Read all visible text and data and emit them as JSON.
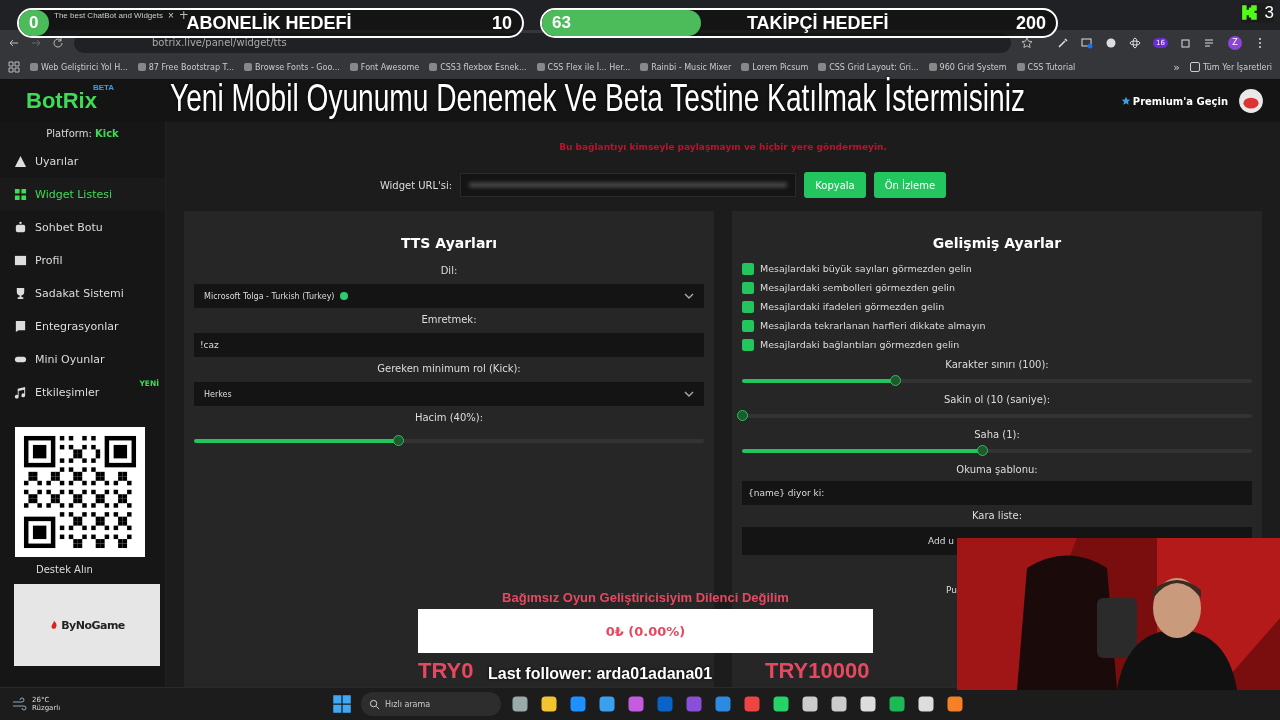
{
  "browser": {
    "tab_title": "The best ChatBot and Widgets",
    "tab_close": "×",
    "new_tab": "+",
    "url": "botrix.live/panel/widget/tts",
    "bookmarks": [
      "Web Geliştirici Yol H...",
      "87 Free Bootstrap T...",
      "Browse Fonts - Goo...",
      "Font Awesome",
      "CSS3 flexbox Esnek...",
      "CSS Flex ile İ... Her...",
      "Rainbi - Music Mixer",
      "Lorem Picsum",
      "CSS Grid Layout: Gri...",
      "960 Grid System",
      "CSS Tutorial"
    ],
    "more": "»",
    "all_bookmarks": "Tüm Yer İşaretleri",
    "extension_badge": "16",
    "profile": "Z"
  },
  "app": {
    "logo": "BotRix",
    "logo_badge": "BETA",
    "premium": "Premium'a Geçin",
    "platform_label": "Platform:",
    "platform": "Kick",
    "sidebar": [
      {
        "label": "Uyarılar",
        "selected": false
      },
      {
        "label": "Widget Listesi",
        "selected": true
      },
      {
        "label": "Sohbet Botu",
        "selected": false
      },
      {
        "label": "Profil",
        "selected": false
      },
      {
        "label": "Sadakat Sistemi",
        "selected": false
      },
      {
        "label": "Entegrasyonlar",
        "selected": false
      },
      {
        "label": "Mini Oyunlar",
        "selected": false
      },
      {
        "label": "Etkileşimler",
        "selected": false,
        "badge": "YENİ"
      }
    ],
    "support": "Destek Alın",
    "warning": "Bu bağlantıyı kimseyle paylaşmayın ve hiçbir yere göndermeyin.",
    "url_label": "Widget URL'si:",
    "copy_button": "Kopyala",
    "preview_button": "Ön İzleme",
    "tts": {
      "title": "TTS Ayarları",
      "fields": [
        {
          "kind": "select",
          "label": "Dil:",
          "value": "Microsoft Tolga - Turkish (Turkey)",
          "color": "#2ecc71"
        },
        {
          "kind": "input",
          "label": "Emretmek:",
          "value": "!caz"
        },
        {
          "kind": "select",
          "label": "Gereken minimum rol (Kick):",
          "value": "Herkes"
        },
        {
          "kind": "slider",
          "label": "Hacim (40%):",
          "level": 0.4
        }
      ]
    },
    "advanced": {
      "title": "Gelişmiş Ayarlar",
      "options": [
        {
          "label": "Mesajlardaki büyük sayıları görmezden gelin",
          "checked": true
        },
        {
          "label": "Mesajlardaki sembolleri görmezden gelin",
          "checked": true
        },
        {
          "label": "Mesajlardaki ifadeleri görmezden gelin",
          "checked": true
        },
        {
          "label": "Mesajlarda tekrarlanan harfleri dikkate almayın",
          "checked": true
        },
        {
          "label": "Mesajlardaki bağlantıları görmezden gelin",
          "checked": true
        }
      ],
      "fields": [
        {
          "kind": "slider",
          "label": "Karakter sınırı (100):",
          "level": 0.3
        },
        {
          "kind": "slider",
          "label": "Sakin ol (10 (saniye):",
          "level": 0.0
        },
        {
          "kind": "slider",
          "label": "Saha (1):",
          "level": 0.47
        },
        {
          "kind": "input",
          "label": "Okuma şablonu:",
          "value": "{name} diyor ki:"
        },
        {
          "kind": "button",
          "label": "Kara liste:",
          "value": "Add u"
        }
      ],
      "cut_label": "Pu"
    }
  },
  "overlay": {
    "goals": [
      {
        "count": "0",
        "title": "ABONELİK HEDEFİ",
        "target": "10",
        "level": 0.0
      },
      {
        "count": "63",
        "title": "TAKİPÇİ HEDEFİ",
        "target": "200",
        "level": 0.31
      }
    ],
    "kick_count": "3",
    "headline": "Yeni Mobil Oyunumu Denemek Ve Beta Testine Katılmak İstermisiniz",
    "sponsor": "ByNoGame",
    "donation": {
      "title": "Bağımsız Oyun Geliştiricisiyim Dilenci Değilim",
      "amount": "0₺ (0.00%)",
      "level": 0.0,
      "min": "TRY0",
      "max": "TRY10000"
    },
    "last_follower": "Last follower: arda01adana01"
  },
  "taskbar": {
    "temperature": "26°C",
    "weather": "Rüzgarlı",
    "search_placeholder": "Hızlı arama"
  }
}
